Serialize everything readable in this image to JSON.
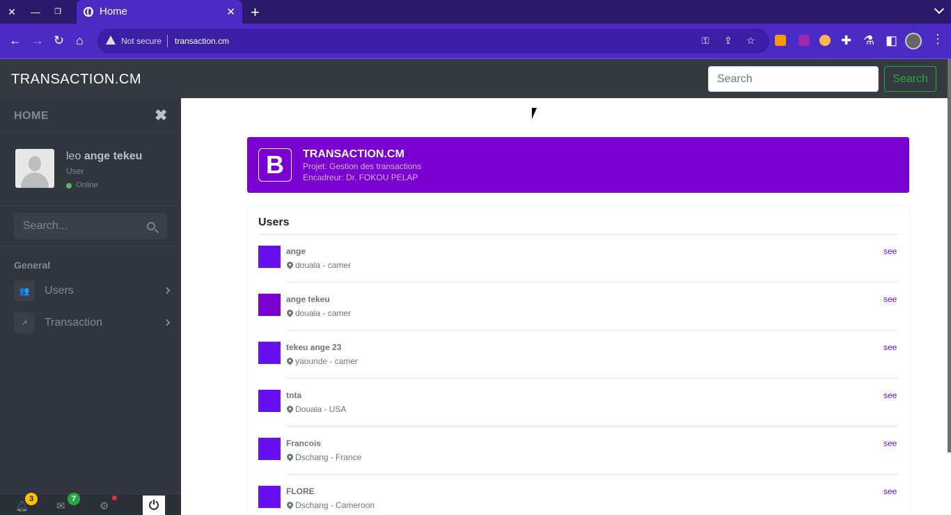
{
  "browser": {
    "tab_title": "Home",
    "security_label": "Not secure",
    "url": "transaction.cm"
  },
  "navbar": {
    "brand": "TRANSACTION.CM",
    "search_placeholder": "Search",
    "search_button": "Search"
  },
  "sidebar": {
    "header": "HOME",
    "user": {
      "first_name": "leo",
      "last_name": "ange tekeu",
      "role": "User",
      "status": "Online"
    },
    "search_placeholder": "Search...",
    "section": "General",
    "items": [
      {
        "label": "Users",
        "icon": "users-icon"
      },
      {
        "label": "Transaction",
        "icon": "share-icon"
      }
    ],
    "footer": {
      "notifications": "3",
      "messages": "7"
    }
  },
  "banner": {
    "logo": "B",
    "title": "TRANSACTION.CM",
    "line1": "Projet: Gestion des transactions",
    "line2": "Encadreur: Dr. FOKOU PELAP"
  },
  "users_card": {
    "title": "Users",
    "link_label": "see",
    "rows": [
      {
        "name": "ange",
        "location": "douala - camer",
        "color": "#6610f2"
      },
      {
        "name": "ange tekeu",
        "location": "douala - camer",
        "color": "#7a00d1"
      },
      {
        "name": "tekeu ange 23",
        "location": "yaounde - camer",
        "color": "#6610f2"
      },
      {
        "name": "tnta",
        "location": "Douala - USA",
        "color": "#6610f2"
      },
      {
        "name": "Francois",
        "location": "Dschang - France",
        "color": "#6610f2"
      },
      {
        "name": "FLORE",
        "location": "Dschang - Cameroon",
        "color": "#6610f2"
      }
    ]
  },
  "colors": {
    "accent": "#7a00d1",
    "link": "#6610f2",
    "success": "#28a745"
  }
}
